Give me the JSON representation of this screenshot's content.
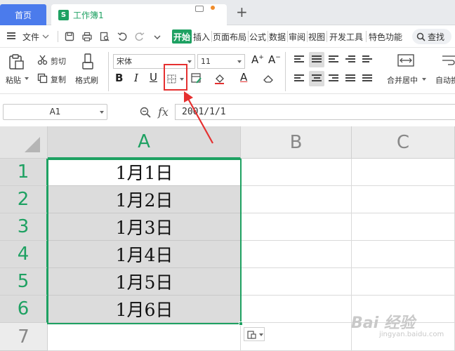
{
  "tabs": {
    "home_label": "首页",
    "doc_badge": "S",
    "doc_title": "工作簿1",
    "new_tab": "+"
  },
  "menu": {
    "file": "文件",
    "items": [
      "开始",
      "插入",
      "页面布局",
      "公式",
      "数据",
      "审阅",
      "视图",
      "开发工具",
      "特色功能"
    ],
    "active": "开始",
    "search": "查找"
  },
  "ribbon": {
    "paste": "粘贴",
    "cut": "剪切",
    "copy": "复制",
    "format_painter": "格式刷",
    "font_name": "宋体",
    "font_size": "11",
    "bold": "B",
    "italic": "I",
    "underline": "U",
    "merge_center": "合并居中",
    "auto_wrap": "自动换"
  },
  "formula_bar": {
    "name_box": "A1",
    "fx": "fx",
    "value": "2001/1/1"
  },
  "grid": {
    "columns": [
      "A",
      "B",
      "C"
    ],
    "rows": [
      "1",
      "2",
      "3",
      "4",
      "5",
      "6",
      "7"
    ],
    "cells_A": [
      "1月1日",
      "1月2日",
      "1月3日",
      "1月4日",
      "1月5日",
      "1月6日"
    ]
  },
  "watermark": {
    "main": "Bai 经验",
    "sub": "jingyan.baidu.com"
  },
  "colors": {
    "accent": "#1ea162",
    "home_tab": "#4b7bec",
    "annotation": "#e53030"
  }
}
